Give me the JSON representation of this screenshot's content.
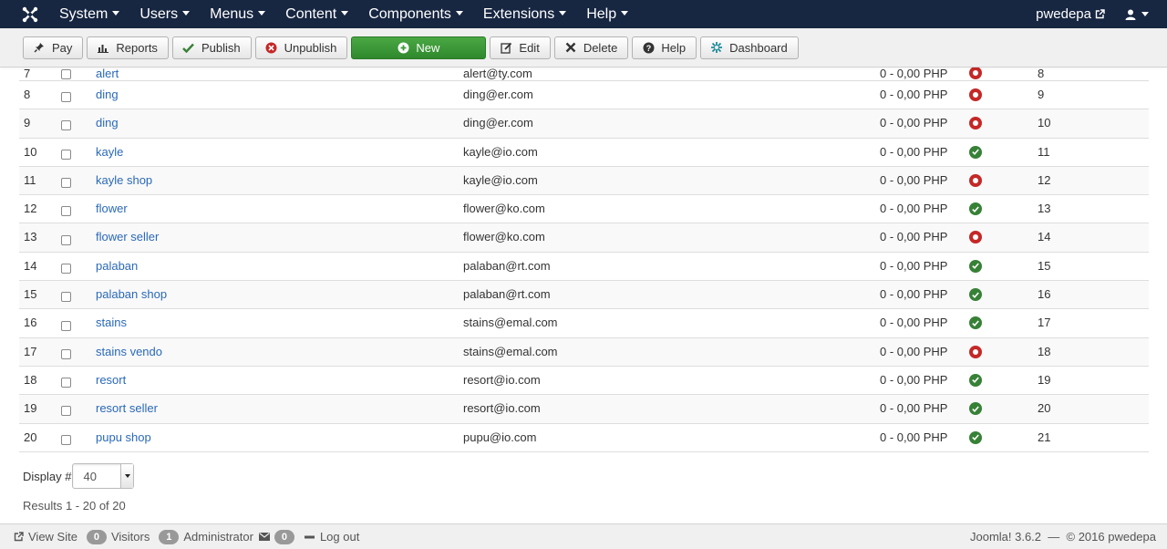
{
  "nav": {
    "menu": [
      "System",
      "Users",
      "Menus",
      "Content",
      "Components",
      "Extensions",
      "Help"
    ],
    "site_name": "pwedepa"
  },
  "toolbar": {
    "pay": "Pay",
    "reports": "Reports",
    "publish": "Publish",
    "unpublish": "Unpublish",
    "new": "New",
    "edit": "Edit",
    "delete": "Delete",
    "help": "Help",
    "dashboard": "Dashboard"
  },
  "rows": [
    {
      "num": "7",
      "name": "alert",
      "email": "alert@ty.com",
      "balance": "0 - 0,00 PHP",
      "published": false,
      "id": "8"
    },
    {
      "num": "8",
      "name": "ding",
      "email": "ding@er.com",
      "balance": "0 - 0,00 PHP",
      "published": false,
      "id": "9"
    },
    {
      "num": "9",
      "name": "ding",
      "email": "ding@er.com",
      "balance": "0 - 0,00 PHP",
      "published": false,
      "id": "10"
    },
    {
      "num": "10",
      "name": "kayle",
      "email": "kayle@io.com",
      "balance": "0 - 0,00 PHP",
      "published": true,
      "id": "11"
    },
    {
      "num": "11",
      "name": "kayle shop",
      "email": "kayle@io.com",
      "balance": "0 - 0,00 PHP",
      "published": false,
      "id": "12"
    },
    {
      "num": "12",
      "name": "flower",
      "email": "flower@ko.com",
      "balance": "0 - 0,00 PHP",
      "published": true,
      "id": "13"
    },
    {
      "num": "13",
      "name": "flower seller",
      "email": "flower@ko.com",
      "balance": "0 - 0,00 PHP",
      "published": false,
      "id": "14"
    },
    {
      "num": "14",
      "name": "palaban",
      "email": "palaban@rt.com",
      "balance": "0 - 0,00 PHP",
      "published": true,
      "id": "15"
    },
    {
      "num": "15",
      "name": "palaban shop",
      "email": "palaban@rt.com",
      "balance": "0 - 0,00 PHP",
      "published": true,
      "id": "16"
    },
    {
      "num": "16",
      "name": "stains",
      "email": "stains@emal.com",
      "balance": "0 - 0,00 PHP",
      "published": true,
      "id": "17"
    },
    {
      "num": "17",
      "name": "stains vendo",
      "email": "stains@emal.com",
      "balance": "0 - 0,00 PHP",
      "published": false,
      "id": "18"
    },
    {
      "num": "18",
      "name": "resort",
      "email": "resort@io.com",
      "balance": "0 - 0,00 PHP",
      "published": true,
      "id": "19"
    },
    {
      "num": "19",
      "name": "resort seller",
      "email": "resort@io.com",
      "balance": "0 - 0,00 PHP",
      "published": true,
      "id": "20"
    },
    {
      "num": "20",
      "name": "pupu shop",
      "email": "pupu@io.com",
      "balance": "0 - 0,00 PHP",
      "published": true,
      "id": "21"
    }
  ],
  "pagination": {
    "display_label": "Display #",
    "display_value": "40",
    "results": "Results 1 - 20 of 20"
  },
  "footer": {
    "view_site": "View Site",
    "visitors_count": "0",
    "visitors_label": "Visitors",
    "admin_count": "1",
    "admin_label": "Administrator",
    "messages_count": "0",
    "logout": "Log out",
    "version": "Joomla! 3.6.2",
    "separator": "—",
    "copyright": "© 2016 pwedepa"
  },
  "colors": {
    "navbar": "#172641",
    "link": "#2a69b8",
    "published": "#378137",
    "unpublished": "#c52827",
    "new_button": "#3d9a39"
  }
}
